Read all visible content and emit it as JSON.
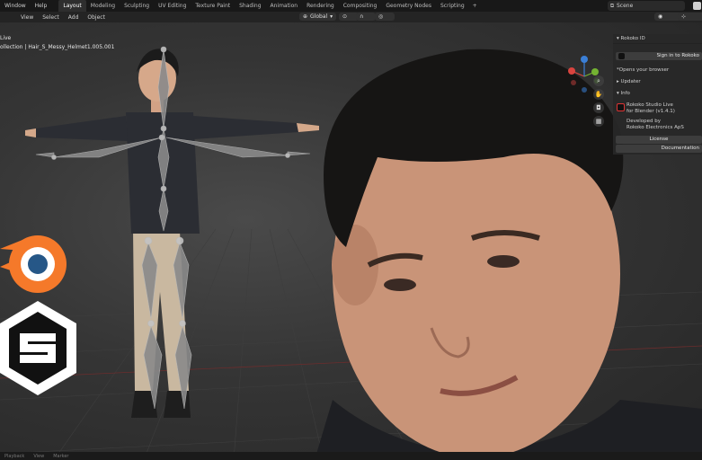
{
  "menu": {
    "items": [
      {
        "label": "Window",
        "name": "menu-window"
      },
      {
        "label": "Help",
        "name": "menu-help"
      }
    ]
  },
  "workspace_tabs": [
    {
      "label": "Layout",
      "active": true
    },
    {
      "label": "Modeling",
      "active": false
    },
    {
      "label": "Sculpting",
      "active": false
    },
    {
      "label": "UV Editing",
      "active": false
    },
    {
      "label": "Texture Paint",
      "active": false
    },
    {
      "label": "Shading",
      "active": false
    },
    {
      "label": "Animation",
      "active": false
    },
    {
      "label": "Rendering",
      "active": false
    },
    {
      "label": "Compositing",
      "active": false
    },
    {
      "label": "Geometry Nodes",
      "active": false
    },
    {
      "label": "Scripting",
      "active": false
    }
  ],
  "add_tab": "+",
  "scene": {
    "label": "Scene"
  },
  "viewport_header": {
    "view": "View",
    "select": "Select",
    "add": "Add",
    "object": "Object",
    "orientation": "Global"
  },
  "viewport": {
    "mode_label": "Live",
    "collection_label": "ollection | Hair_S_Messy_Helmet1.005.001"
  },
  "rokoko_panel": {
    "id_header": "Rokoko ID",
    "sign_in_label": "Sign in to Rokoko",
    "opens_browser": "*Opens your browser",
    "updater_header": "Updater",
    "info_header": "Info",
    "app_name": "Rokoko Studio Live",
    "app_version": "for Blender (v1.4.1)",
    "developed_by": "Developed by",
    "developer": "Rokoko Electronics ApS",
    "license_label": "License",
    "documentation_label": "Documentation"
  },
  "bottom_bar": {
    "items": [
      "Playback",
      "View",
      "Marker"
    ]
  },
  "colors": {
    "blender_orange": "#f5792a",
    "blender_blue": "#265787",
    "axis_x": "#d9443f",
    "axis_y": "#74b332",
    "axis_z": "#3b7fd6"
  }
}
